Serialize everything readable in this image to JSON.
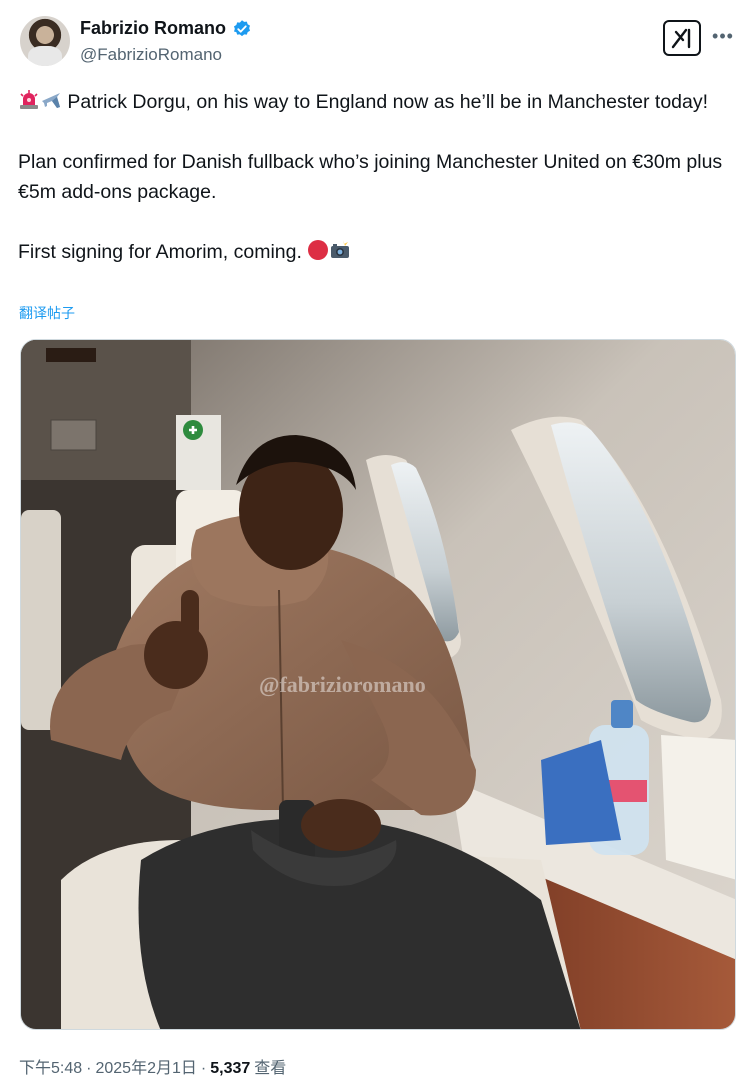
{
  "author": {
    "display_name": "Fabrizio Romano",
    "handle": "@FabrizioRomano",
    "verified": true
  },
  "header_icons": {
    "grok": "grok-icon",
    "more": "more-icon"
  },
  "tweet": {
    "line1_text": "Patrick Dorgu, on his way to England now as he’ll be in Manchester today!",
    "line1_emojis": [
      "siren-emoji",
      "airplane-emoji"
    ],
    "line2_text": "Plan confirmed for Danish fullback who’s joining Manchester United on €30m plus €5m add-ons package.",
    "line3_text": "First signing for Amorim, coming.",
    "line3_emojis": [
      "red-circle-emoji",
      "camera-flash-emoji"
    ]
  },
  "translate_label": "翻译帖子",
  "photo": {
    "watermark": "@fabrizioromano"
  },
  "meta": {
    "time": "下午5:48",
    "separator": "·",
    "date": "2025年2月1日",
    "separator2": "·",
    "views": "5,337",
    "views_label": "查看"
  },
  "colors": {
    "link": "#1d9bf0",
    "verified": "#1d9bf0",
    "secondary_text": "#536471",
    "primary_text": "#0f1419"
  }
}
